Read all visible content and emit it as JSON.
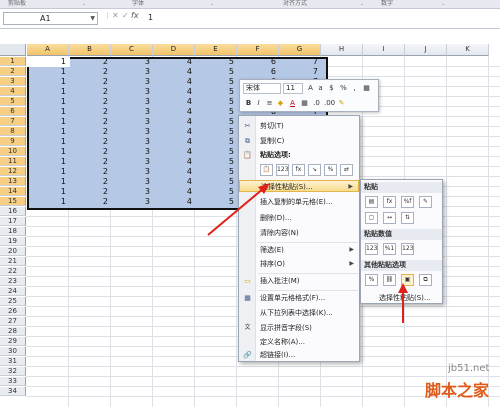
{
  "ribbon": {
    "groups": [
      "剪贴板",
      "字体",
      "对齐方式",
      "数字"
    ],
    "launcher": "⌄"
  },
  "formula_bar": {
    "name_box": "A1",
    "fx": "fx",
    "value": "1"
  },
  "columns": [
    "A",
    "B",
    "C",
    "D",
    "E",
    "F",
    "G",
    "H",
    "I",
    "J",
    "K"
  ],
  "rows": [
    "1",
    "2",
    "3",
    "4",
    "5",
    "6",
    "7",
    "8",
    "9",
    "10",
    "11",
    "12",
    "13",
    "14",
    "15",
    "16",
    "17",
    "18",
    "19",
    "20",
    "21",
    "22",
    "23",
    "24",
    "25",
    "26",
    "27",
    "28",
    "29",
    "30",
    "31",
    "32",
    "33",
    "34"
  ],
  "row_values": [
    1,
    2,
    3,
    4,
    5,
    6,
    7
  ],
  "mini_toolbar": {
    "font": "宋体",
    "size": "11",
    "bold": "B",
    "italic": "I",
    "font_color": "A",
    "percent": "%",
    "comma": ","
  },
  "context_menu": {
    "items": [
      {
        "label": "剪切(T)",
        "icon": "scissors-icon"
      },
      {
        "label": "复制(C)",
        "icon": "copy-icon"
      },
      {
        "label": "粘贴选项:",
        "icon": "paste-icon"
      },
      {
        "label": "选择性粘贴(S)...",
        "icon": ""
      },
      {
        "label": "插入复制的单元格(E)...",
        "icon": ""
      },
      {
        "label": "删除(D)...",
        "icon": ""
      },
      {
        "label": "清除内容(N)",
        "icon": ""
      },
      {
        "label": "筛选(E)",
        "icon": ""
      },
      {
        "label": "排序(O)",
        "icon": ""
      },
      {
        "label": "插入批注(M)",
        "icon": "comment-icon"
      },
      {
        "label": "设置单元格格式(F)...",
        "icon": "format-cells-icon"
      },
      {
        "label": "从下拉列表中选择(K)...",
        "icon": ""
      },
      {
        "label": "显示拼音字段(S)",
        "icon": "phonetic-icon"
      },
      {
        "label": "定义名称(A)...",
        "icon": ""
      },
      {
        "label": "超链接(I)...",
        "icon": "hyperlink-icon"
      }
    ],
    "paste_buttons": [
      "📋",
      "123",
      "fx",
      "↘",
      "%",
      "⇄"
    ]
  },
  "paste_submenu": {
    "section1": "粘贴",
    "section2": "粘贴数值",
    "section3": "其他粘贴选项",
    "more": "选择性粘贴(S)..."
  },
  "watermark": {
    "site": "jb51.net",
    "brand": "脚本之家"
  },
  "colors": {
    "selection": "#b5c8e6",
    "arrow": "#e0201b",
    "highlight": "#f8dc8e"
  }
}
